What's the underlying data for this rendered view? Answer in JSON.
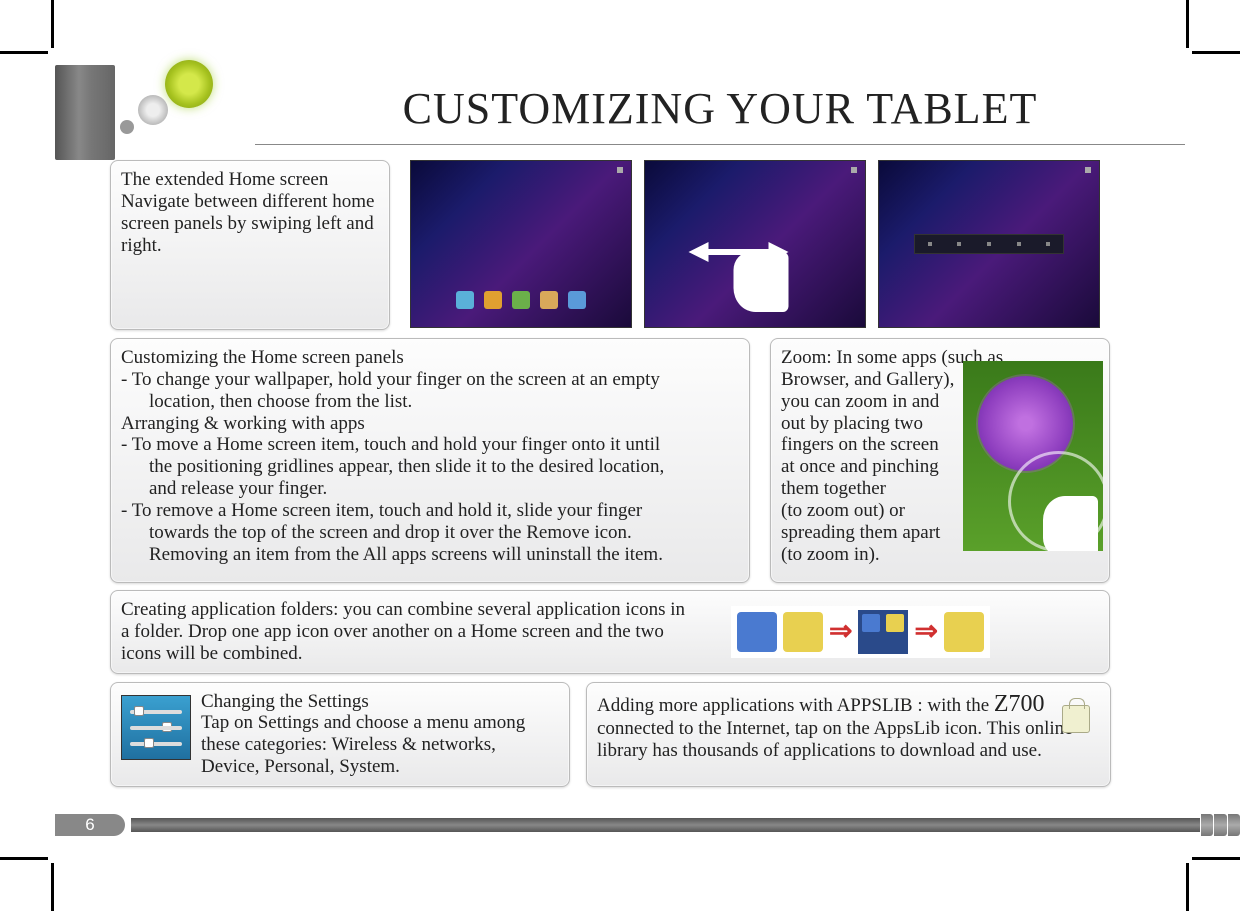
{
  "title": "CUSTOMIZING YOUR TABLET",
  "page_number": "6",
  "box_extended_home": {
    "heading": "The extended Home screen",
    "body": "Navigate between different home screen panels by swiping left and right."
  },
  "box_customizing": {
    "heading": "Customizing the Home screen panels",
    "wallpaper": "- To change your wallpaper, hold your finger on the screen at an empty",
    "wallpaper_cont": "location, then choose from the list.",
    "arranging_heading": "Arranging & working with apps",
    "move": "- To move a Home screen item, touch and hold your finger onto it until",
    "move_cont1": "the positioning gridlines appear, then slide it to the desired location,",
    "move_cont2": "and release your finger.",
    "remove": "- To remove a Home screen item, touch and hold it, slide your finger",
    "remove_cont1": "towards the top of the screen and drop it over the Remove icon.",
    "remove_cont2": "Removing an item from the All apps screens will uninstall the item."
  },
  "box_zoom": {
    "line1": "Zoom: In some apps (such as",
    "line2": "Browser, and Gallery),",
    "line3": "you can zoom in and",
    "line4": "out by placing two",
    "line5": "fingers on the screen",
    "line6": "at once and pinching",
    "line7": "them together",
    "line8": "(to zoom out) or",
    "line9": "spreading them apart",
    "line10": "(to zoom in)."
  },
  "box_folders": {
    "text": "Creating application folders: you can combine several application icons in a folder. Drop one app icon over another on a Home screen and the two icons will be combined."
  },
  "box_settings": {
    "heading": "Changing the Settings",
    "body": "Tap on Settings and choose a menu among these categories: Wireless & networks, Device, Personal, System."
  },
  "box_appslib": {
    "lead": "Adding more applications with APPSLIB : with the ",
    "model": "Z700",
    "body": " connected to the Internet, tap on the AppsLib icon. This online library has thousands of applications to download and use."
  }
}
